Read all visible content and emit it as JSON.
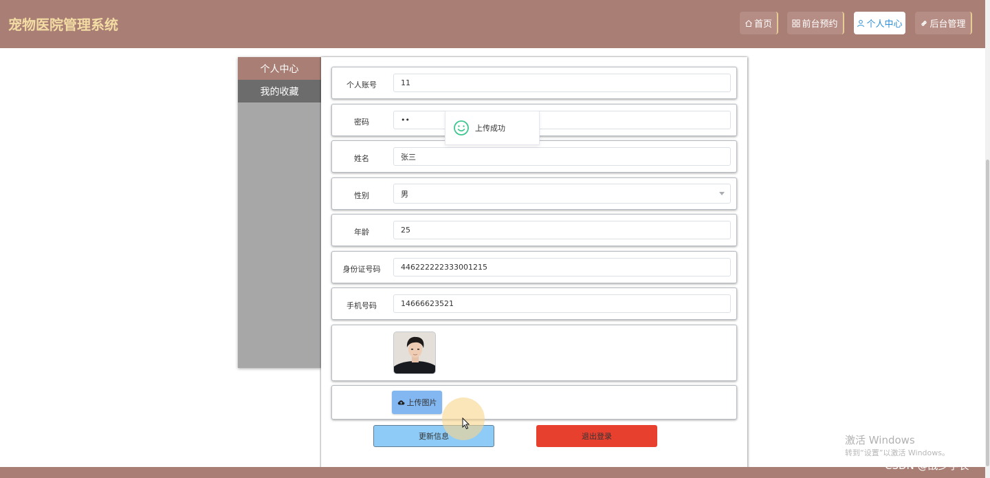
{
  "header": {
    "brand": "宠物医院管理系统",
    "nav": [
      {
        "icon": "home-icon",
        "label": "首页"
      },
      {
        "icon": "grid-icon",
        "label": "前台预约"
      },
      {
        "icon": "user-icon",
        "label": "个人中心",
        "active": true
      },
      {
        "icon": "link-icon",
        "label": "后台管理"
      }
    ]
  },
  "sidebar": {
    "items": [
      {
        "label": "个人中心",
        "active": true
      },
      {
        "label": "我的收藏"
      }
    ]
  },
  "form": {
    "account": {
      "label": "个人账号",
      "value": "11"
    },
    "password": {
      "label": "密码",
      "value": "••"
    },
    "name": {
      "label": "姓名",
      "value": "张三"
    },
    "gender": {
      "label": "性别",
      "value": "男"
    },
    "age": {
      "label": "年龄",
      "value": "25"
    },
    "id_number": {
      "label": "身份证号码",
      "value": "446222222333001215"
    },
    "phone": {
      "label": "手机号码",
      "value": "14666623521"
    },
    "upload_label": "上传图片",
    "update_label": "更新信息",
    "logout_label": "退出登录"
  },
  "toast": {
    "message": "上传成功"
  },
  "watermarks": {
    "windows_title": "激活 Windows",
    "windows_sub": "转到“设置”以激活 Windows。",
    "csdn": "CSDN @战少学长"
  },
  "colors": {
    "header_bg": "#a97e74",
    "brand_text": "#f3dca4",
    "active_nav_text": "#2d8ed8",
    "update_btn": "#8ecbf6",
    "logout_btn": "#e8402f",
    "toast_icon": "#3dc68f"
  }
}
